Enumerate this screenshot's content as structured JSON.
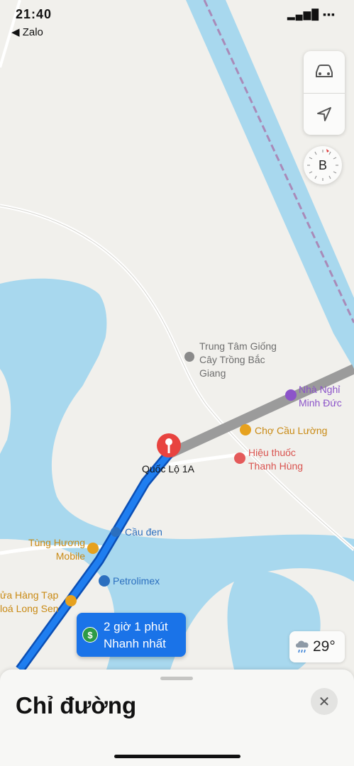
{
  "status_bar": {
    "time": "21:40",
    "signal": "▂▄▆█ ▪▪▪"
  },
  "back_nav": {
    "label": "◀ Zalo"
  },
  "controls": {
    "car_icon": "car-icon",
    "locate_icon": "location-arrow-icon",
    "compass_letter": "B"
  },
  "map": {
    "places": [
      {
        "key": "trung_tam",
        "lines": [
          "Trung Tâm Giống",
          "Cây Trồng Bắc",
          "Giang"
        ],
        "color": "#6e6e6e"
      },
      {
        "key": "nha_nghi",
        "lines": [
          "Nhà Nghỉ",
          "Minh Đức"
        ],
        "color": "#8c54c9"
      },
      {
        "key": "cho",
        "lines": [
          "Chợ Cầu Lường"
        ],
        "color": "#c98a14"
      },
      {
        "key": "hieu_thuoc",
        "lines": [
          "Hiệu thuốc",
          "Thanh Hùng"
        ],
        "color": "#d9534f"
      },
      {
        "key": "quoc_lo",
        "lines": [
          "Quốc Lộ 1A"
        ],
        "color": "#111111"
      },
      {
        "key": "cau_den",
        "lines": [
          "Cầu đen"
        ],
        "color": "#2b6fbf"
      },
      {
        "key": "tung_huong",
        "lines": [
          "Tùng Hương",
          "Mobile"
        ],
        "color": "#c98a14"
      },
      {
        "key": "petrolimex",
        "lines": [
          "Petrolimex"
        ],
        "color": "#2b6fbf"
      },
      {
        "key": "cua_hang",
        "lines": [
          "ửa Hàng Tạp",
          "loá Long Sen"
        ],
        "color": "#c98a14"
      }
    ]
  },
  "route": {
    "duration": "2 giờ 1 phút",
    "subtitle": "Nhanh nhất",
    "badge_icon": "$",
    "route_color": "#1a73e8"
  },
  "weather": {
    "temperature": "29°",
    "icon": "cloud-rain-icon"
  },
  "sheet": {
    "title": "Chỉ đường",
    "close_label": "✕"
  }
}
